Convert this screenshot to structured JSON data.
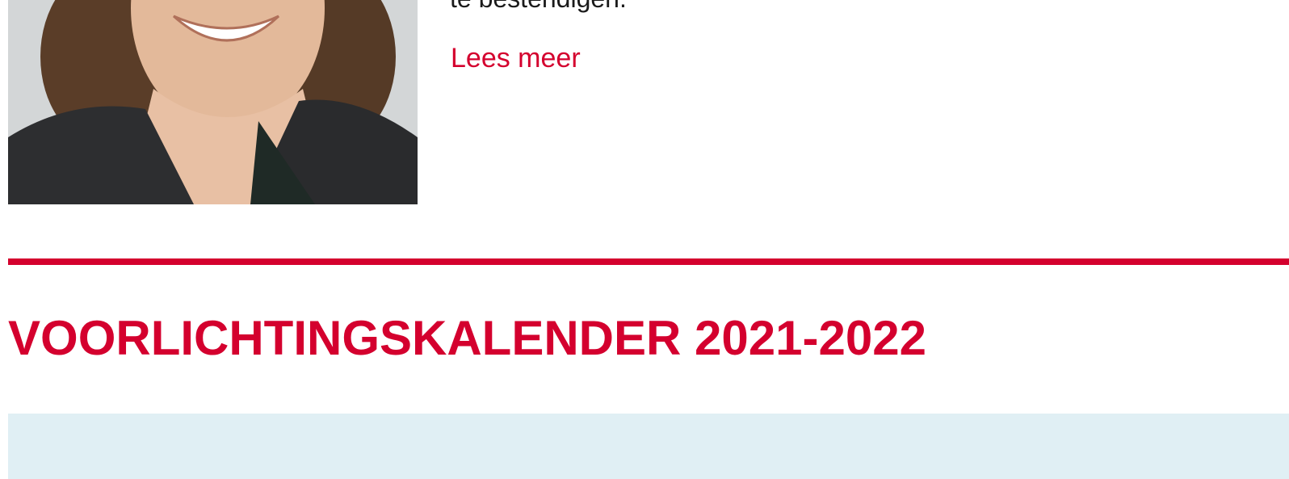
{
  "article": {
    "text_tail": "te bestendigen.",
    "read_more_label": "Lees meer"
  },
  "section": {
    "title": "VOORLICHTINGSKALENDER 2021-2022"
  },
  "colors": {
    "accent": "#d4002e",
    "panel_background": "#e0eff4",
    "text": "#1a1a1a"
  }
}
